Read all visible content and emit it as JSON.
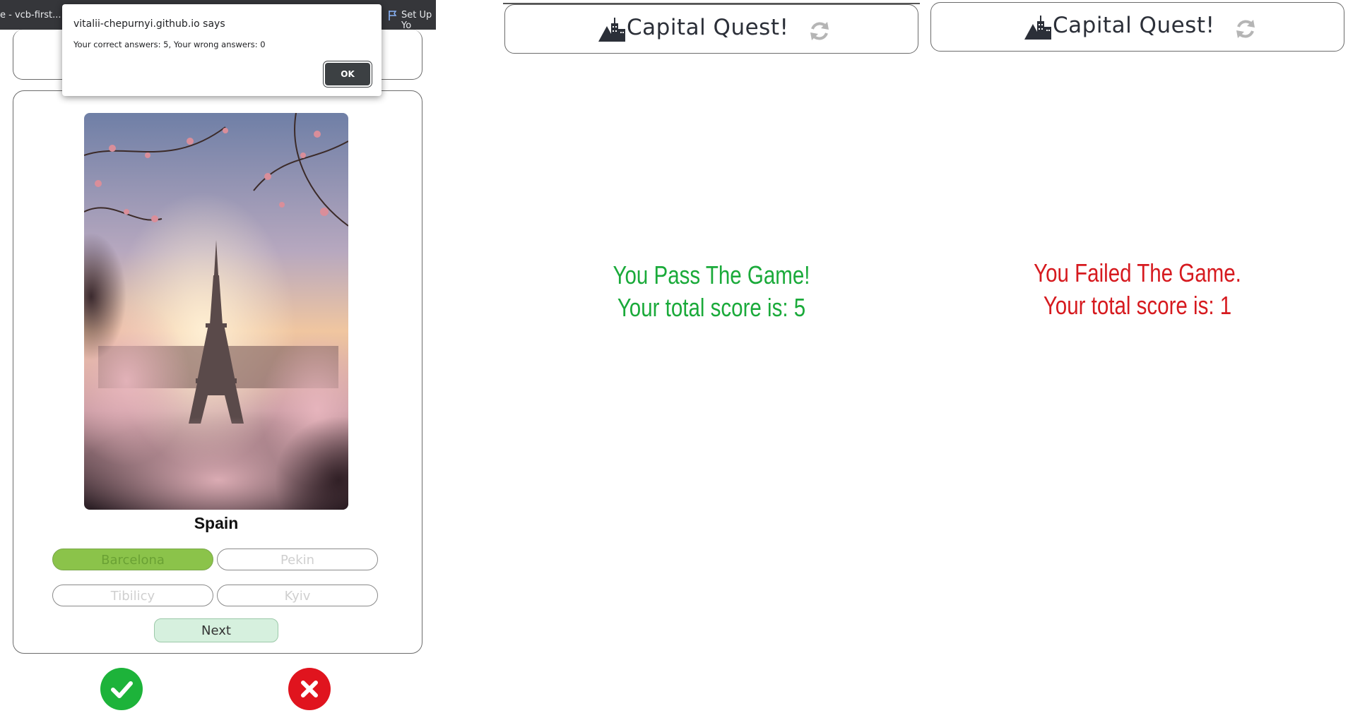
{
  "browser": {
    "tab_left": "e - vcb-first...",
    "tab_right": "Set Up Yo"
  },
  "alert": {
    "title": "vitalii-chepurnyi.github.io says",
    "message": "Your correct answers: 5, Your wrong answers: 0",
    "ok_label": "OK"
  },
  "game": {
    "photo_alt": "Eiffel Tower seen through cherry blossom branches",
    "country": "Spain",
    "answers": [
      {
        "label": "Barcelona",
        "state": "selected"
      },
      {
        "label": "Pekin",
        "state": "normal"
      },
      {
        "label": "Tibilicy",
        "state": "normal"
      },
      {
        "label": "Kyiv",
        "state": "normal"
      }
    ],
    "next_label": "Next",
    "icons": {
      "correct": "checkmark-icon",
      "wrong": "close-icon"
    }
  },
  "header": {
    "title": "Capital Quest!",
    "logo_icon": "mountain-city-icon",
    "reload_icon": "reload-icon"
  },
  "pass_screen": {
    "line1": "You Pass The Game!",
    "line2": "Your total score is: 5",
    "color": "#1aaa3a"
  },
  "fail_screen": {
    "line1": "You Failed The Game.",
    "line2": "Your total score is: 1",
    "color": "#d61a1f"
  }
}
